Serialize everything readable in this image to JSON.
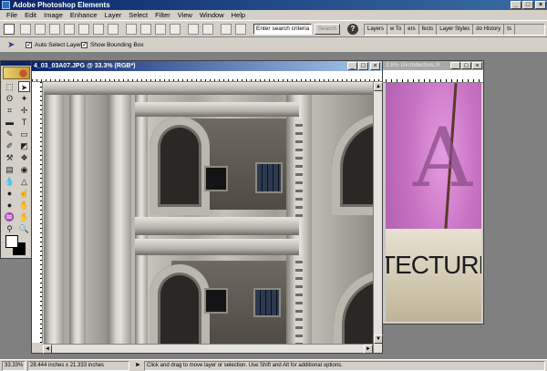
{
  "app": {
    "title": "Adobe Photoshop Elements"
  },
  "window_controls": {
    "minimize": "_",
    "maximize": "□",
    "close": "×"
  },
  "menu": [
    "File",
    "Edit",
    "Image",
    "Enhance",
    "Layer",
    "Select",
    "Filter",
    "View",
    "Window",
    "Help"
  ],
  "shortcuts": {
    "search_value": "Enter search criteria",
    "search_button": "Search",
    "help_symbol": "?"
  },
  "palette_well": [
    "Layers",
    "w To",
    "ers",
    "fects",
    "Layer Styles",
    "do History",
    "ts"
  ],
  "options": {
    "auto_select_label": "Auto Select Layer",
    "auto_select_checked": "✓",
    "bounding_box_label": "Show Bounding Box",
    "bounding_box_checked": "✓"
  },
  "document_main": {
    "title": "4_03_03A07.JPG @ 33.3% (RGB*)"
  },
  "document_second": {
    "title": "3.8% (Architecture,R",
    "text": "TECTURE",
    "letter": "A"
  },
  "status": {
    "zoom": "33.33%",
    "size": "28.444 inches x 21.333 inches",
    "hint": "Click and drag to move layer or selection. Use Shift and Alt for additional options."
  },
  "icons": {
    "move_tool": "move-arrow-icon",
    "scroll_up": "▲",
    "scroll_down": "▼",
    "scroll_left": "◄",
    "scroll_right": "►",
    "status_arrow": "►"
  },
  "colors": {
    "titlebar_start": "#0a246a",
    "titlebar_end": "#3a6ea5",
    "chrome": "#d4d0c8",
    "foreground": "#ffffff",
    "background": "#000000"
  }
}
